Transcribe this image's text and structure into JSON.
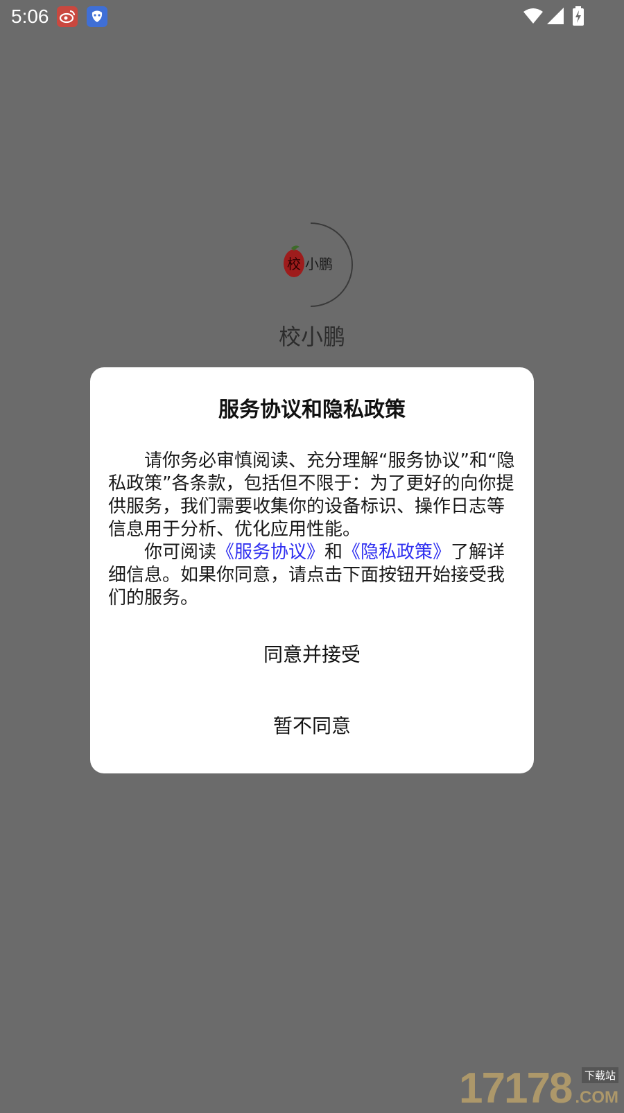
{
  "status_bar": {
    "time": "5:06",
    "notification_icons": [
      "weibo-icon",
      "bird-app-icon"
    ],
    "system_icons": [
      "wifi-icon",
      "signal-icon",
      "battery-charging-icon"
    ]
  },
  "splash": {
    "logo_icon": "xiaoxiaopeng-logo",
    "app_name": "校小鹏"
  },
  "dialog": {
    "title": "服务协议和隐私政策",
    "paragraph1": "请你务必审慎阅读、充分理解“服务协议”和“隐私政策”各条款，包括但不限于：为了更好的向你提供服务，我们需要收集你的设备标识、操作日志等信息用于分析、优化应用性能。",
    "paragraph2_prefix": "你可阅读",
    "link_service": "《服务协议》",
    "paragraph2_and": "和",
    "link_privacy": "《隐私政策》",
    "paragraph2_suffix": "了解详细信息。如果你同意，请点击下面按钮开始接受我们的服务。",
    "agree_button": "同意并接受",
    "disagree_button": "暂不同意",
    "link_color": "#2f2ff0"
  },
  "watermark": {
    "number": "17178",
    "tag": "下载站",
    "suffix": ".COM"
  }
}
